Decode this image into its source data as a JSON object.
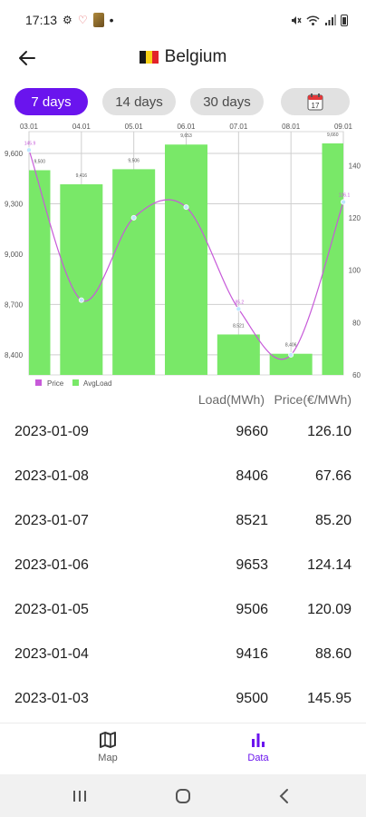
{
  "status": {
    "time": "17:13",
    "dot": "•"
  },
  "app": {
    "title": "Belgium"
  },
  "colors": {
    "accent": "#6a14ee",
    "bar": "#79e868",
    "price_line": "#c75ad9",
    "flag_black": "#1a1a1a",
    "flag_yellow": "#f7d117",
    "flag_red": "#e2232a"
  },
  "icons": {
    "back": "arrow-back-icon",
    "calendar": "calendar-icon",
    "map": "map-icon",
    "data": "bar-chart-icon"
  },
  "range_tabs": [
    {
      "label": "7 days",
      "active": true
    },
    {
      "label": "14 days",
      "active": false
    },
    {
      "label": "30 days",
      "active": false
    }
  ],
  "calendar_day": "17",
  "chart_data": {
    "type": "bar",
    "categories": [
      "03.01",
      "04.01",
      "05.01",
      "06.01",
      "07.01",
      "08.01",
      "09.01"
    ],
    "series": [
      {
        "name": "AvgLoad",
        "type": "bar",
        "axis": "left",
        "values": [
          9500,
          9416,
          9506,
          9653,
          8521,
          8406,
          9660
        ]
      },
      {
        "name": "Price",
        "type": "line",
        "axis": "right",
        "values": [
          145.95,
          88.6,
          120.09,
          124.14,
          85.2,
          67.66,
          126.1
        ]
      }
    ],
    "bar_labels": [
      "9,500",
      "9,416",
      "9,506",
      "9,653",
      "8,521",
      "8,406",
      "9,660"
    ],
    "price_labels": [
      "145.9",
      "",
      "",
      "",
      "85.2",
      "",
      "126.1"
    ],
    "left_axis": {
      "ticks": [
        "9,600",
        "9,300",
        "9,000",
        "8,700",
        "8,400"
      ],
      "range": [
        8280,
        9730
      ]
    },
    "right_axis": {
      "ticks": [
        "140",
        "120",
        "100",
        "80",
        "60"
      ],
      "range": [
        60,
        153
      ]
    },
    "legend": [
      "Price",
      "AvgLoad"
    ],
    "legend_position": "bottom-left",
    "grid": true
  },
  "table": {
    "headers": {
      "load": "Load(MWh)",
      "price": "Price(€/MWh)"
    },
    "rows": [
      {
        "date": "2023-01-09",
        "load": "9660",
        "price": "126.10"
      },
      {
        "date": "2023-01-08",
        "load": "8406",
        "price": "67.66"
      },
      {
        "date": "2023-01-07",
        "load": "8521",
        "price": "85.20"
      },
      {
        "date": "2023-01-06",
        "load": "9653",
        "price": "124.14"
      },
      {
        "date": "2023-01-05",
        "load": "9506",
        "price": "120.09"
      },
      {
        "date": "2023-01-04",
        "load": "9416",
        "price": "88.60"
      },
      {
        "date": "2023-01-03",
        "load": "9500",
        "price": "145.95"
      }
    ]
  },
  "bottom_nav": [
    {
      "label": "Map",
      "active": false
    },
    {
      "label": "Data",
      "active": true
    }
  ]
}
